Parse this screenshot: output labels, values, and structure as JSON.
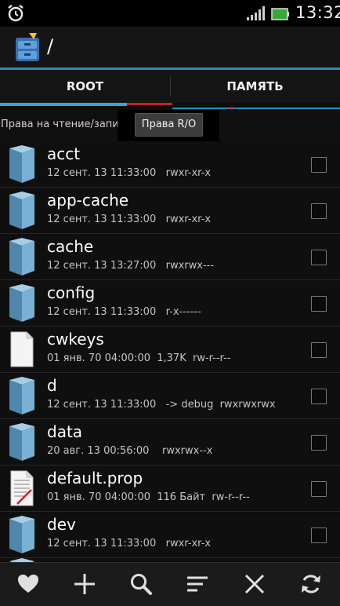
{
  "status_bar": {
    "time": "13:32",
    "icons": [
      "alarm-clock-icon",
      "signal-icon",
      "battery-icon"
    ]
  },
  "action_bar": {
    "path": "/",
    "logo_icon": "root-explorer-logo-icon"
  },
  "tabs": [
    {
      "label": "ROOT",
      "active": true
    },
    {
      "label": "ПАМЯТЬ",
      "active": false
    }
  ],
  "permission": {
    "label": "Права на чтение/запись",
    "popup": "Права R/O"
  },
  "files": [
    {
      "name": "acct",
      "type": "folder",
      "meta": "12 сент. 13 11:33:00   rwxr-xr-x"
    },
    {
      "name": "app-cache",
      "type": "folder",
      "meta": "12 сент. 13 11:33:00   rwxr-xr-x"
    },
    {
      "name": "cache",
      "type": "folder",
      "meta": "12 сент. 13 13:27:00   rwxrwx---"
    },
    {
      "name": "config",
      "type": "folder",
      "meta": "12 сент. 13 11:33:00   r-x------"
    },
    {
      "name": "cwkeys",
      "type": "file",
      "meta": "01 янв. 70 04:00:00  1,37K  rw-r--r--"
    },
    {
      "name": "d",
      "type": "folder",
      "meta": "12 сент. 13 11:33:00   -> debug  rwxrwxrwx"
    },
    {
      "name": "data",
      "type": "folder",
      "meta": "20 авг. 13 00:56:00    rwxrwx--x"
    },
    {
      "name": "default.prop",
      "type": "file-text",
      "meta": "01 янв. 70 04:00:00  116 Байт  rw-r--r--"
    },
    {
      "name": "dev",
      "type": "folder",
      "meta": "12 сент. 13 11:33:00   rwxr-xr-x"
    }
  ],
  "toolbar": {
    "buttons": [
      {
        "icon": "heart-icon"
      },
      {
        "icon": "plus-icon"
      },
      {
        "icon": "search-icon"
      },
      {
        "icon": "sort-icon"
      },
      {
        "icon": "close-icon"
      },
      {
        "icon": "refresh-icon"
      }
    ]
  },
  "colors": {
    "accent": "#38a4d8",
    "folder": "#6aa0c4",
    "marker": "#c42020"
  }
}
